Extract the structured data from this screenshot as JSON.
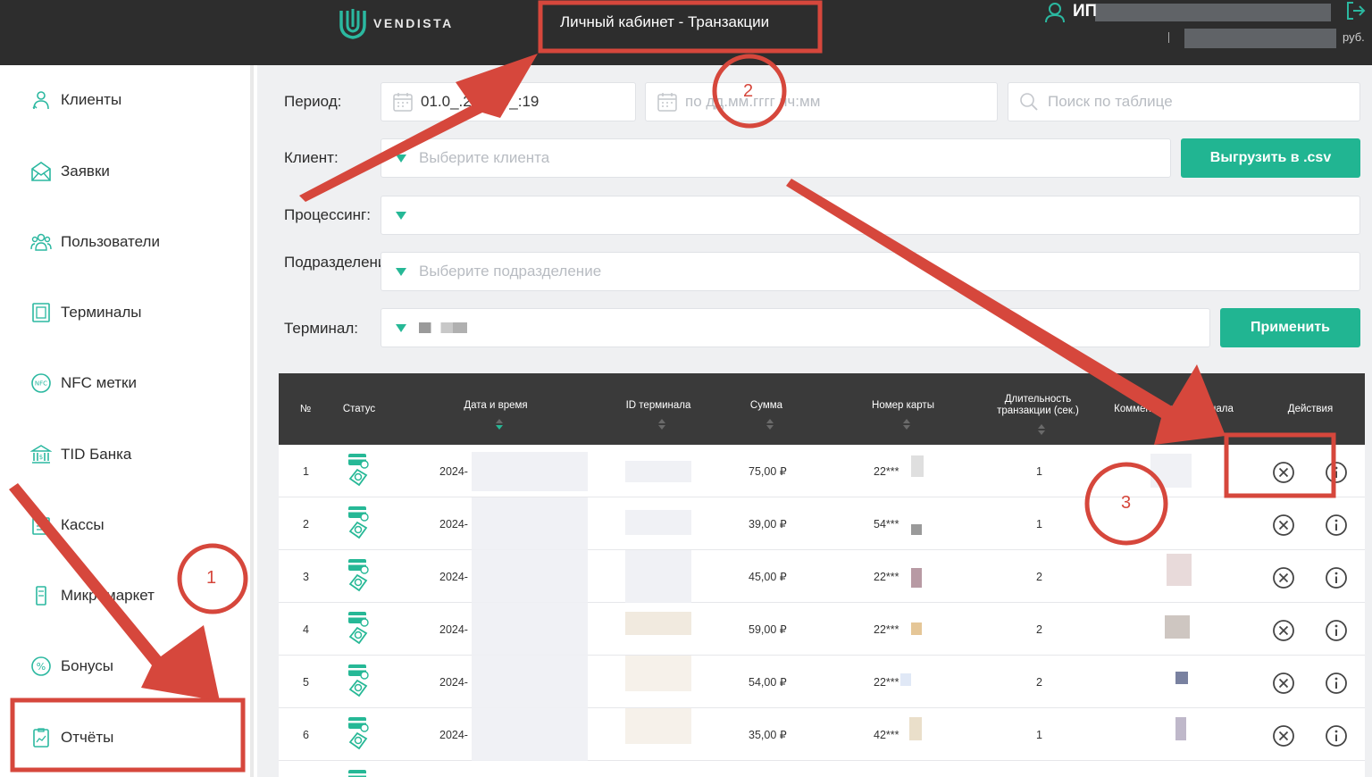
{
  "header": {
    "logo_text": "VENDISTA",
    "page_title": "Личный кабинет - Транзакции",
    "user_name": "ИП",
    "currency": "руб."
  },
  "sidebar": {
    "items": [
      {
        "label": "Клиенты",
        "icon": "clients-icon"
      },
      {
        "label": "Заявки",
        "icon": "requests-icon"
      },
      {
        "label": "Пользователи",
        "icon": "users-icon"
      },
      {
        "label": "Терминалы",
        "icon": "terminal-icon"
      },
      {
        "label": "NFC метки",
        "icon": "nfc-icon"
      },
      {
        "label": "TID Банка",
        "icon": "bank-icon"
      },
      {
        "label": "Кассы",
        "icon": "cashbox-icon"
      },
      {
        "label": "Микромаркет",
        "icon": "micromarket-icon"
      },
      {
        "label": "Бонусы",
        "icon": "bonus-icon"
      },
      {
        "label": "Отчёты",
        "icon": "reports-icon"
      }
    ]
  },
  "filters": {
    "period_label": "Период:",
    "period_from": "01.0_.2024 0_:19",
    "period_to_placeholder": "по дд.мм.гггг чч:мм",
    "search_placeholder": "Поиск по таблице",
    "client_label": "Клиент:",
    "client_placeholder": "Выберите клиента",
    "export_button": "Выгрузить в .csv",
    "processing_label": "Процессинг:",
    "division_label": "Подразделение:",
    "division_placeholder": "Выберите подразделение",
    "terminal_label": "Терминал:",
    "apply_button": "Применить"
  },
  "table": {
    "columns": [
      "№",
      "Статус",
      "Дата и время",
      "ID терминала",
      "Сумма",
      "Номер карты",
      "Длительность транзакции (сек.)",
      "Комментарий терминала",
      "Действия"
    ],
    "rows": [
      {
        "n": "1",
        "date": "2024-",
        "sum": "75,00 ₽",
        "card": "22***",
        "duration": "1"
      },
      {
        "n": "2",
        "date": "2024-",
        "sum": "39,00 ₽",
        "card": "54***",
        "duration": "1"
      },
      {
        "n": "3",
        "date": "2024-",
        "sum": "45,00 ₽",
        "card": "22***",
        "duration": "2"
      },
      {
        "n": "4",
        "date": "2024-",
        "sum": "59,00 ₽",
        "card": "22***",
        "duration": "2"
      },
      {
        "n": "5",
        "date": "2024-",
        "sum": "54,00 ₽",
        "card": "22***",
        "duration": "2"
      },
      {
        "n": "6",
        "date": "2024-",
        "sum": "35,00 ₽",
        "card": "42***",
        "duration": "1"
      }
    ]
  },
  "annotations": {
    "marker_1": "1",
    "marker_2": "2",
    "marker_3": "3"
  },
  "colors": {
    "accent": "#21b592",
    "header_bg": "#2d2d2d",
    "annotation_red": "#d6473c"
  }
}
